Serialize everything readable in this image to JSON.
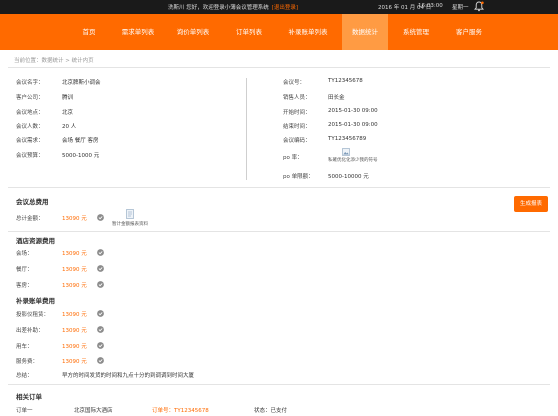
{
  "topbar": {
    "welcome": "洗斯川 您好，欢迎登录小薄会议管理系统",
    "logout": "[退出登录]",
    "date": "2016 年 01 月 04 日",
    "time": "16:03:00",
    "weekday": "星期一"
  },
  "nav": {
    "items": [
      "首页",
      "需求单列表",
      "询价单列表",
      "订单列表",
      "补录账单列表",
      "数据统计",
      "系统管理",
      "客户服务"
    ],
    "active_index": 5
  },
  "breadcrumb": "当前位置：数据统计 > 统计内页",
  "meeting_info": {
    "left": [
      {
        "label": "会议名字：",
        "value": "北京脾斯小调会"
      },
      {
        "label": "客户公司：",
        "value": "腾训"
      },
      {
        "label": "会议地点：",
        "value": "北京"
      },
      {
        "label": "会议人数：",
        "value": "20 人"
      },
      {
        "label": "会议需求：",
        "value": "会场  餐厅  客房"
      },
      {
        "label": "会议预算：",
        "value": "5000-1000 元"
      }
    ],
    "right": [
      {
        "label": "会议号：",
        "value": "TY12345678"
      },
      {
        "label": "销售人员：",
        "value": "田长金"
      },
      {
        "label": "开始时间：",
        "value": "2015-01-30  09:00"
      },
      {
        "label": "结束时间：",
        "value": "2015-01-30  09:00"
      },
      {
        "label": "会议编码：",
        "value": "TY123456789"
      },
      {
        "label": "po 率：",
        "value": ""
      },
      {
        "label": "po 单限额：",
        "value": "5000-10000 元"
      }
    ],
    "po_note": "私確优化化添少我的符号"
  },
  "total_section": {
    "title": "会议总费用",
    "generate_button": "生成报表",
    "total_label": "总计金额：",
    "total_value": "13090 元",
    "doc_note": "暂计金额报表资料"
  },
  "hotel_section": {
    "title": "酒店资源费用",
    "rows": [
      {
        "label": "会场：",
        "value": "13090 元"
      },
      {
        "label": "餐厅：",
        "value": "13090 元"
      },
      {
        "label": "客房：",
        "value": "13090 元"
      }
    ]
  },
  "supplement_section": {
    "title": "补录账单费用",
    "rows": [
      {
        "label": "投影仪租赁：",
        "value": "13090 元"
      },
      {
        "label": "出差补助：",
        "value": "13090 元"
      },
      {
        "label": "用车：",
        "value": "13090 元"
      },
      {
        "label": "服务费：",
        "value": "13090 元"
      }
    ],
    "remark_label": "总结：",
    "remark_value": "早方的时间发货的时间和九点十分的到调调到时间大厦"
  },
  "related_orders": {
    "title": "相关订单",
    "row": {
      "label": "订单一",
      "hotel": "北京国际大酒店",
      "order_no": "订单号：TY12345678",
      "status": "状态：已支付"
    }
  },
  "colors": {
    "accent": "#ff6a00",
    "nav_active": "#ff9b43",
    "topbar": "#1a1a1a",
    "check": "#8c8c8c"
  }
}
